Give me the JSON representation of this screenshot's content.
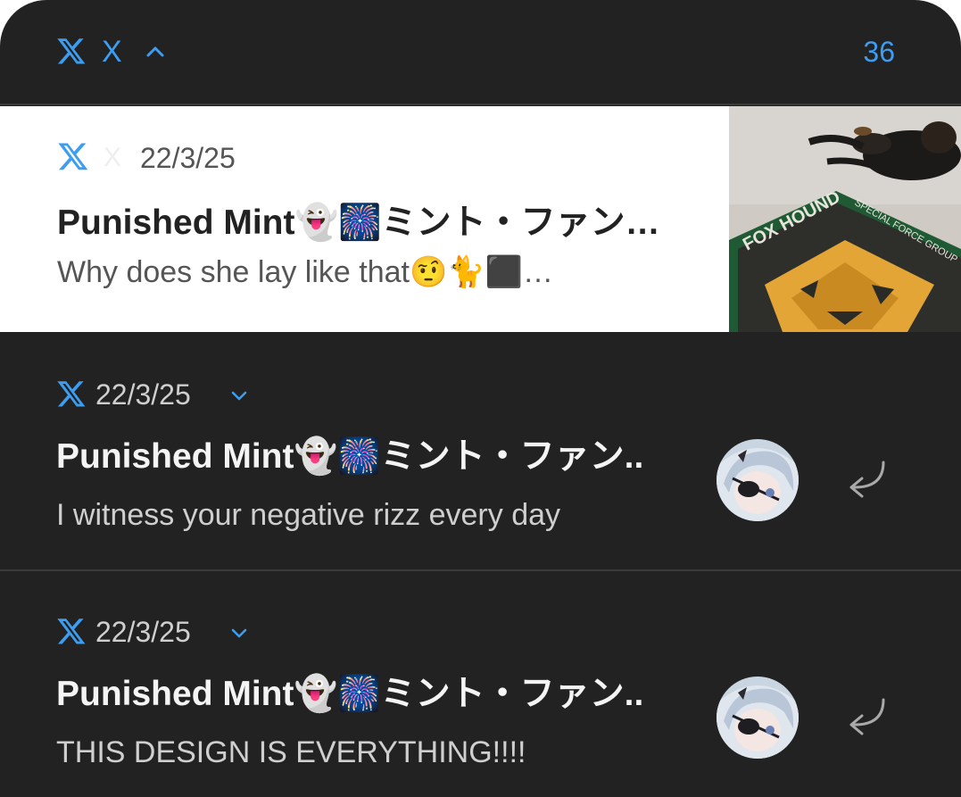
{
  "header": {
    "app_name": "X",
    "count": "36"
  },
  "notifications": [
    {
      "app_name": "X",
      "time": "22/3/25",
      "title": "Punished Mint👻🎆ミント・ファン…",
      "body": "Why does she lay like that🤨🐈⬛…",
      "image_text": [
        "FOX HOUND",
        "SPECIAL FORCE GROUP"
      ]
    },
    {
      "time": "22/3/25",
      "title": "Punished Mint👻🎆ミント・ファン..",
      "body": "I witness your negative rizz every day"
    },
    {
      "time": "22/3/25",
      "title": "Punished Mint👻🎆ミント・ファン..",
      "body": "THIS DESIGN IS EVERYTHING!!!!"
    }
  ],
  "colors": {
    "accent": "#3d9df0",
    "panel_bg": "#222222",
    "divider": "#3a3a3a"
  },
  "icons": {
    "app": "x-logo-icon",
    "collapse": "chevron-up-icon",
    "expand": "chevron-down-icon",
    "reply": "reply-arrow-icon"
  }
}
